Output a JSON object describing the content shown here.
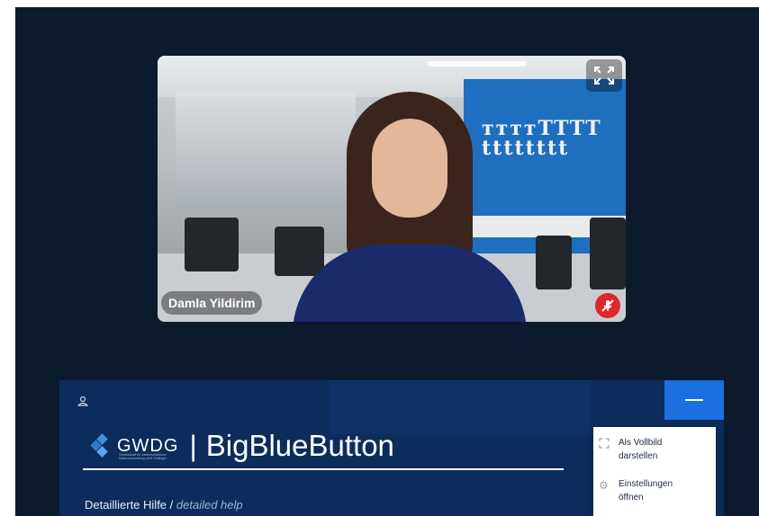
{
  "video": {
    "participant_name": "Damla Yildirim",
    "fullscreen_icon": "fullscreen-expand-icon",
    "mic_status_icon": "mic-muted-icon",
    "mic_status_color": "#e0252c"
  },
  "panel": {
    "user_icon": "user-icon",
    "logo_text": "GWDG",
    "logo_subtext": "Gesellschaft für wissenschaftliche Datenverarbeitung mbH Göttingen",
    "separator": "|",
    "product_name": "BigBlueButton",
    "help_label": "Detaillierte Hilfe",
    "help_slash": " / ",
    "help_label_en": "detailed help",
    "minimize_icon": "minus-icon"
  },
  "menu": {
    "items": [
      {
        "label": "Als Vollbild darstellen",
        "icon": "fullscreen-icon"
      },
      {
        "label": "Einstellungen öffnen",
        "icon": "gear-icon"
      }
    ]
  },
  "colors": {
    "background": "#0b1a2c",
    "panel": "#0c2c5c",
    "accent": "#1b6fe0"
  }
}
